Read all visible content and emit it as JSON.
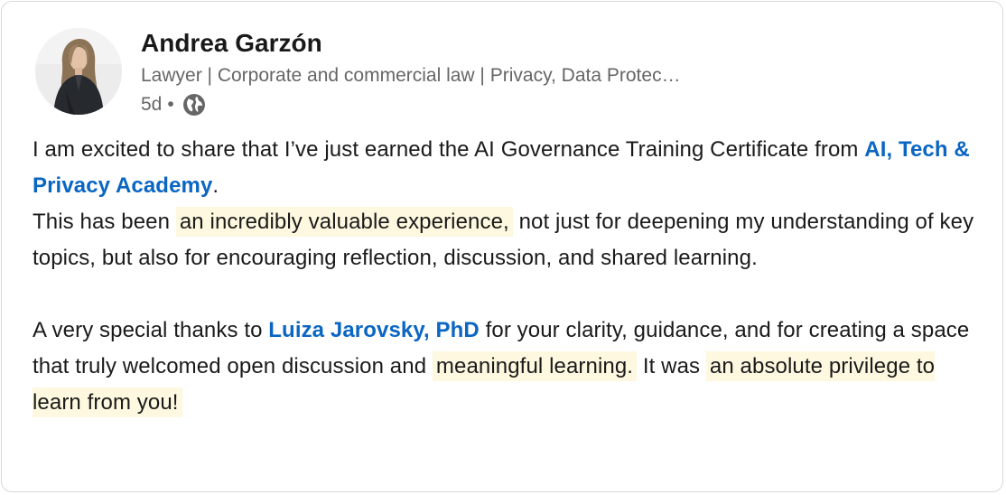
{
  "author": {
    "name": "Andrea Garzón",
    "headline": "Lawyer | Corporate and commercial law | Privacy, Data Protec…",
    "time": "5d",
    "separator": "•",
    "visibility_icon": "globe-icon"
  },
  "post": {
    "line1_before": "I am excited to share that I’ve just earned the AI Governance Training Certificate from ",
    "mention1": "AI, Tech & Privacy Academy",
    "line1_after": ".",
    "line2_before": "This has been ",
    "highlight1": "an incredibly valuable experience,",
    "line2_after": " not just for deepening my understanding of key topics, but also for encouraging reflection, discussion, and shared learning.",
    "para2_before": "A very special thanks to ",
    "mention2": "Luiza Jarovsky, PhD",
    "para2_mid": " for your clarity, guidance, and for creating a space that truly welcomed open discussion and ",
    "highlight2": "meaningful learning.",
    "para2_mid2": " It was ",
    "highlight3": "an absolute privilege to learn from you!"
  },
  "colors": {
    "mention": "#0a66c2",
    "highlight": "#fdf8df",
    "name": "#191919",
    "secondary": "#666666",
    "border": "#d9d9d9"
  }
}
